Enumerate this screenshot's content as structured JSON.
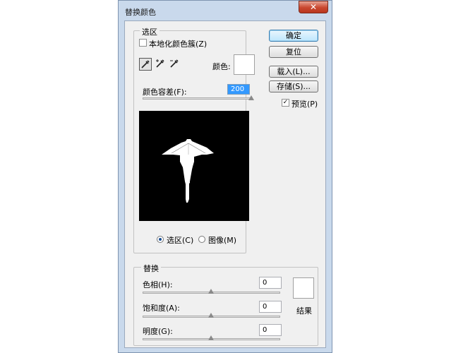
{
  "window": {
    "title": "替换颜色",
    "close_glyph": "✕"
  },
  "selection": {
    "legend": "选区",
    "localized_clusters_label": "本地化颜色簇(Z)",
    "color_label": "颜色:",
    "color_value": "#ffffff",
    "tolerance_label": "颜色容差(F):",
    "tolerance_value": "200",
    "tolerance_fraction": 1.0,
    "radio_selection": "选区(C)",
    "radio_image": "图像(M)",
    "selected_radio": "selection",
    "tools": [
      "eyedropper-icon",
      "eyedropper-plus-icon",
      "eyedropper-minus-icon"
    ]
  },
  "buttons": {
    "ok": "确定",
    "reset": "复位",
    "load": "载入(L)...",
    "save": "存储(S)..."
  },
  "preview": {
    "label": "预览(P)",
    "checked": true
  },
  "replace": {
    "legend": "替换",
    "hue_label": "色相(H):",
    "hue_value": "0",
    "saturation_label": "饱和度(A):",
    "saturation_value": "0",
    "lightness_label": "明度(G):",
    "lightness_value": "0",
    "result_label": "结果",
    "result_color": "#ffffff"
  },
  "colors": {
    "accent": "#3399ff",
    "preview_bg": "#000000",
    "mask": "#ffffff"
  }
}
